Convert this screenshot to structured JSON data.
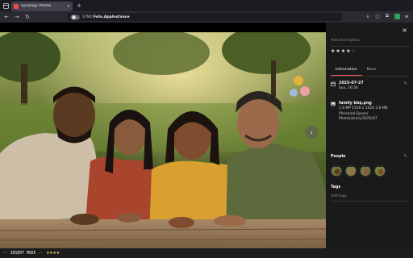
{
  "browser": {
    "tab_title": "Synology Photos",
    "tab_close": "×",
    "new_tab": "+",
    "url_host": "SYNO:",
    "url_path": "Foto.AppInstance"
  },
  "photo_panel": {
    "close": "×",
    "description_placeholder": "Add description",
    "rating": 4,
    "rating_max": 5,
    "tabs": [
      "Information",
      "More"
    ],
    "active_tab": "Information",
    "date": "2025-07-27",
    "time": "Sun, 16:56",
    "file_name": "family bbq.png",
    "file_meta": "1.6 MP   1536 x 1024  2.8 MB",
    "file_path_1": "/Personal Space/",
    "file_path_2": "PhotoLibrary/2025/07",
    "people_title": "People",
    "tags_title": "Tags",
    "tags_placeholder": "Add tags"
  },
  "status": {
    "mode": "-- INSERT MODE --",
    "stars": "★★★★"
  },
  "colors": {
    "accent": "#e05a4f",
    "panel_bg": "#1a1a1a"
  }
}
